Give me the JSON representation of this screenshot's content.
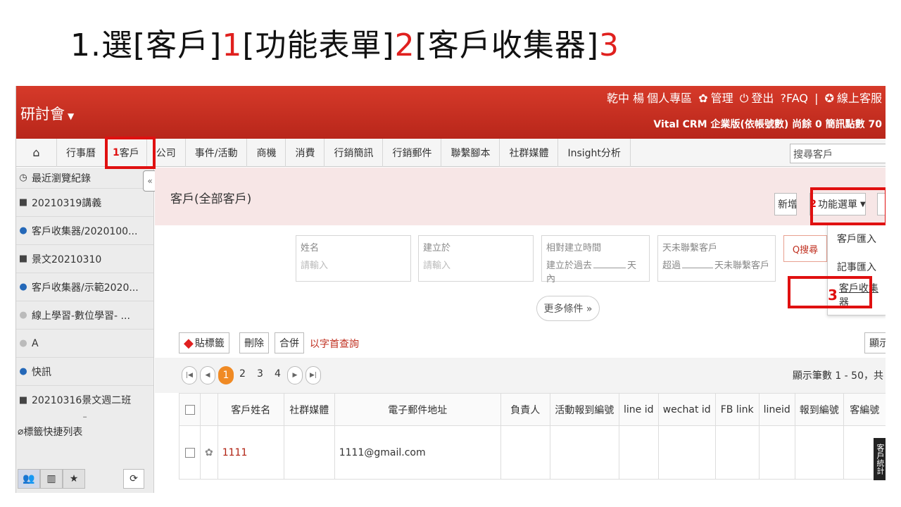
{
  "slide": {
    "title_parts": [
      "1.選[客戶]",
      "1",
      "[功能表單]",
      "2",
      "[客戶收集器]",
      "3"
    ]
  },
  "header": {
    "brand": "研討會",
    "user": "乾中 楊",
    "personal": "個人專區",
    "manage": "管理",
    "logout": "登出",
    "faq": "?FAQ",
    "sep": "|",
    "support": "線上客服",
    "edition": "Vital CRM 企業版(依帳號數) 尚餘 0 簡訊點數 70"
  },
  "nav": {
    "items": [
      "行事曆",
      "客戶",
      "公司",
      "事件/活動",
      "商機",
      "消費",
      "行銷簡訊",
      "行銷郵件",
      "聯繫腳本",
      "社群媒體",
      "Insight分析"
    ],
    "active_prefix": "1",
    "search_placeholder": "搜尋客戶"
  },
  "sidebar": {
    "recent_title": "最近瀏覽紀錄",
    "items": [
      {
        "icon": "briefcase-icon",
        "label": "20210319講義"
      },
      {
        "icon": "people-icon",
        "label": "客戶收集器/2020100..."
      },
      {
        "icon": "briefcase-icon",
        "label": "景文20210310"
      },
      {
        "icon": "people-icon",
        "label": "客戶收集器/示範2020..."
      },
      {
        "icon": "person-icon",
        "label": "線上學習-數位學習- ..."
      },
      {
        "icon": "person-icon",
        "label": "A"
      },
      {
        "icon": "people-icon",
        "label": "快訊"
      },
      {
        "icon": "briefcase-icon",
        "label": "20210316景文週二班"
      }
    ],
    "tag_title": "標籤快捷列表"
  },
  "main": {
    "page_title": "客戶(全部客戶)",
    "new_button": "新增",
    "menu_button": "功能選單",
    "menu_number": "2",
    "menu_options": [
      "客戶匯入",
      "記事匯入",
      "客戶收集器"
    ],
    "collector_number": "3",
    "filters": [
      {
        "label": "姓名",
        "value": "請輸入"
      },
      {
        "label": "建立於",
        "value": "請輸入"
      },
      {
        "label": "相對建立時間",
        "value": "建立於過去",
        "suffix": "天內"
      },
      {
        "label": "天未聯繫客戶",
        "value": "超過",
        "suffix": "天未聯繫客戶"
      }
    ],
    "search_button": "Q搜尋",
    "more_conditions": "更多條件 »",
    "actions": {
      "tag": "貼標籤",
      "delete": "刪除",
      "merge": "合併",
      "alpha": "以字首查詢",
      "columns": "顯示欄位"
    },
    "pager": {
      "pages": [
        "1",
        "2",
        "3",
        "4"
      ],
      "current": "1",
      "count": "顯示筆數 1 - 50，共"
    },
    "table": {
      "headers": [
        "客戶姓名",
        "社群媒體",
        "電子郵件地址",
        "負責人",
        "活動報到編號",
        "line id",
        "wechat id",
        "FB link",
        "lineid",
        "報到編號",
        "客編號"
      ],
      "rows": [
        {
          "name": "1111",
          "email": "1111@gmail.com"
        }
      ]
    },
    "side_tab": "客戶統計"
  },
  "colors": {
    "header_red": "#c5301f",
    "annotation_red": "#e01010",
    "active_page": "#f08a24"
  }
}
